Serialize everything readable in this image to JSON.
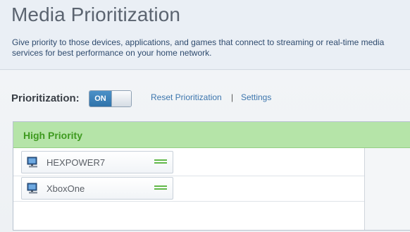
{
  "header": {
    "title": "Media Prioritization",
    "description": "Give priority to those devices, applications, and games that connect to streaming or real-time media services for best performance on your home network."
  },
  "controls": {
    "label": "Prioritization:",
    "toggle_state": "ON",
    "reset_link": "Reset Prioritization",
    "separator": "|",
    "settings_link": "Settings"
  },
  "panel": {
    "title": "High Priority",
    "devices": [
      {
        "name": "HEXPOWER7",
        "icon": "computer-icon"
      },
      {
        "name": "XboxOne",
        "icon": "computer-icon"
      }
    ]
  },
  "colors": {
    "accent_blue": "#2f73aa",
    "priority_green": "#3e9a1f",
    "priority_header_bg": "#b5e4a8"
  }
}
